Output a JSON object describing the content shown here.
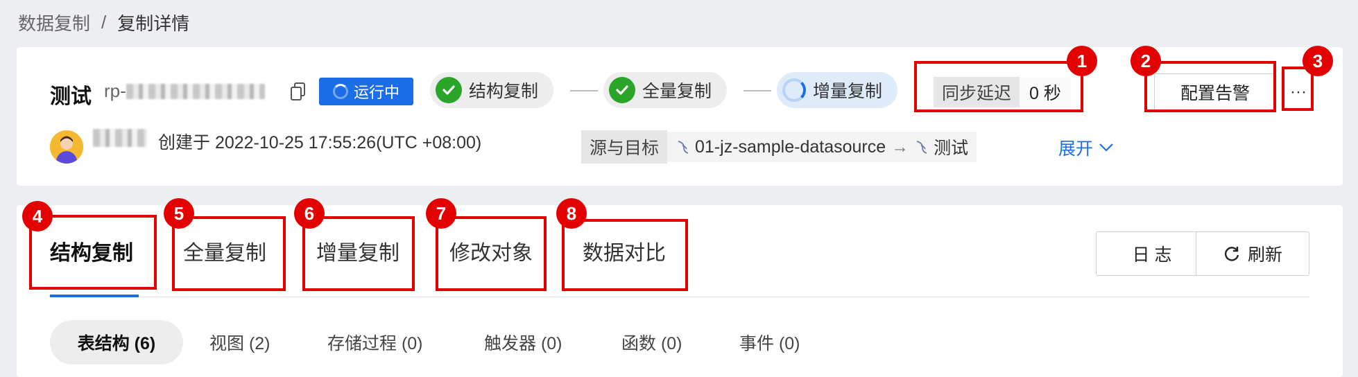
{
  "breadcrumb": {
    "parent": "数据复制",
    "separator": "/",
    "current": "复制详情"
  },
  "task": {
    "name": "测试",
    "id_prefix": "rp-",
    "status": "运行中"
  },
  "stages": [
    {
      "label": "结构复制",
      "state": "done"
    },
    {
      "label": "全量复制",
      "state": "done"
    },
    {
      "label": "增量复制",
      "state": "running"
    }
  ],
  "sync_delay": {
    "label": "同步延迟",
    "value": "0 秒"
  },
  "actions": {
    "configure_alert": "配置告警",
    "more": "···"
  },
  "created": {
    "text": "创建于 2022-10-25 17:55:26(UTC +08:00)"
  },
  "source_target": {
    "label": "源与目标",
    "source": "01-jz-sample-datasource",
    "arrow": "→",
    "target": "测试"
  },
  "expand": "展开",
  "tabs": [
    "结构复制",
    "全量复制",
    "增量复制",
    "修改对象",
    "数据对比"
  ],
  "toolbar": {
    "log": "日 志",
    "refresh": "刷新"
  },
  "subtabs": [
    "表结构 (6)",
    "视图 (2)",
    "存储过程 (0)",
    "触发器 (0)",
    "函数 (0)",
    "事件 (0)"
  ],
  "callouts": [
    "1",
    "2",
    "3",
    "4",
    "5",
    "6",
    "7",
    "8"
  ],
  "colors": {
    "accent": "#1c6ee8",
    "success": "#2aa52a",
    "callout": "#e30000"
  }
}
